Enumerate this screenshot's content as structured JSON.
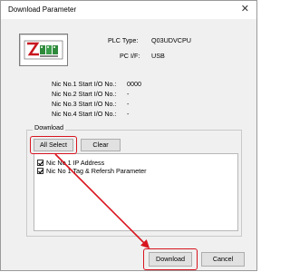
{
  "window": {
    "title": "Download Parameter"
  },
  "info": {
    "plc_type_label": "PLC Type:",
    "plc_type_value": "Q03UDVCPU",
    "pcif_label": "PC I/F:",
    "pcif_value": "USB",
    "nic": [
      {
        "label": "Nic No.1 Start I/O No.:",
        "value": "0000"
      },
      {
        "label": "Nic No.2 Start I/O No.:",
        "value": "-"
      },
      {
        "label": "Nic No.3 Start I/O No.:",
        "value": "-"
      },
      {
        "label": "Nic No.4 Start I/O No.:",
        "value": "-"
      }
    ]
  },
  "download_group": {
    "label": "Download",
    "all_select": "All Select",
    "clear": "Clear",
    "items": [
      {
        "label": "Nic No 1 IP Address",
        "checked": true
      },
      {
        "label": "Nic No 1 Tag & Refersh Parameter",
        "checked": true
      }
    ]
  },
  "footer": {
    "download": "Download",
    "cancel": "Cancel"
  },
  "colors": {
    "highlight": "#d8141f",
    "logo_red": "#c8161e",
    "logo_green": "#2f8a3c"
  }
}
